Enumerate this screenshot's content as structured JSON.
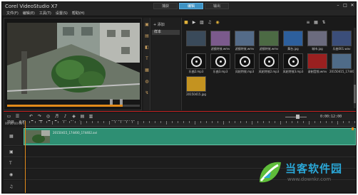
{
  "app": {
    "title": "Corel VideoStudio X7"
  },
  "tabs": [
    {
      "label": "捕获"
    },
    {
      "label": "编辑"
    },
    {
      "label": "输出"
    }
  ],
  "window_controls": [
    "minimize",
    "maximize",
    "close"
  ],
  "menu": [
    "文件(F)",
    "编辑(E)",
    "工具(T)",
    "设置(S)",
    "帮助(H)"
  ],
  "player": {
    "mode_project": "项目",
    "mode_clip": "素材",
    "timecode": "00:00:00:00",
    "progress": 0.87
  },
  "library": {
    "add_label": "添加",
    "folder": "样本",
    "items": [
      {
        "label": "",
        "kind": "image",
        "color": "#3a4a5a"
      },
      {
        "label": "滤镜特效.wmv",
        "kind": "image",
        "color": "#7b5a8c"
      },
      {
        "label": "滤镜特效.wmv",
        "kind": "image",
        "color": "#546b88"
      },
      {
        "label": "滤镜特效.wmv",
        "kind": "image",
        "color": "#4c6a44"
      },
      {
        "label": "舞台.jpg",
        "kind": "image",
        "color": "#2d5f9c"
      },
      {
        "label": "城市.jpg",
        "kind": "image",
        "color": "#6b6b7e"
      },
      {
        "label": "乐曲001.wav",
        "kind": "image",
        "color": "#3b4e7a"
      },
      {
        "label": "乐曲2.mp3",
        "kind": "audio",
        "color": "#111111"
      },
      {
        "label": "乐曲3.mp3",
        "kind": "audio",
        "color": "#111111"
      },
      {
        "label": "风轮特效.mp3",
        "kind": "audio",
        "color": "#111111"
      },
      {
        "label": "风轮特效2.mp3",
        "kind": "audio",
        "color": "#111111"
      },
      {
        "label": "风轮特效3.mp3",
        "kind": "audio",
        "color": "#111111"
      },
      {
        "label": "录制音频.wmv",
        "kind": "image",
        "color": "#9a2020"
      },
      {
        "label": "20150415_174400.jpg",
        "kind": "image",
        "color": "#4f6b88"
      },
      {
        "label": "20150415.jpg",
        "kind": "image",
        "color": "#c49320"
      }
    ]
  },
  "timeline": {
    "duration": "0:00:12:00",
    "ruler_label": "00:00:00:00",
    "clip_label": "20150415_174400_174402.avi",
    "track_icons": [
      "video-track-icon",
      "overlay-track-icon",
      "title-track-icon",
      "voice-track-icon",
      "music-track-icon"
    ]
  },
  "watermark": {
    "brand": "当客软件园",
    "url": "www.downkr.com"
  }
}
